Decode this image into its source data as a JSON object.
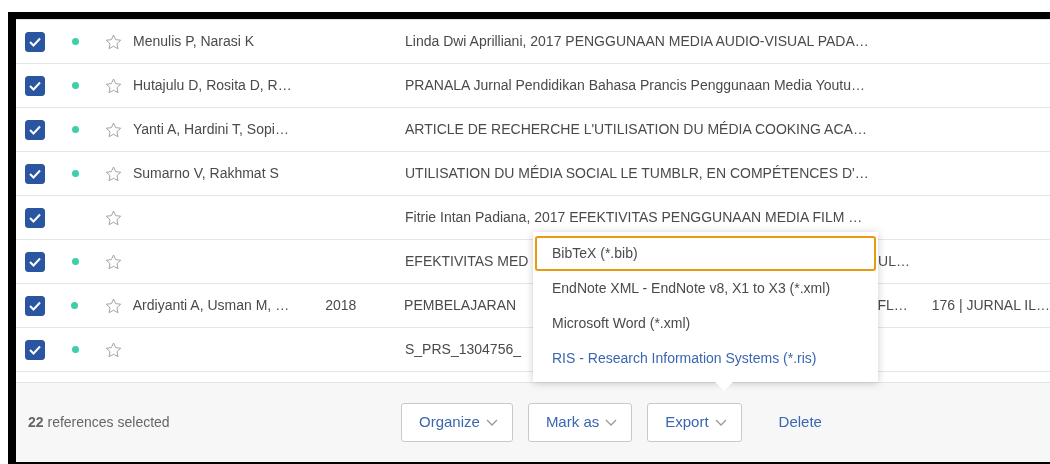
{
  "rows": [
    {
      "checked": true,
      "unread": true,
      "starred": false,
      "authors": "Menulis P, Narasi K",
      "title": "Linda Dwi Aprilliani, 2017 PENGGUNAAN MEDIA AUDIO-VISUAL PADA…"
    },
    {
      "checked": true,
      "unread": true,
      "starred": false,
      "authors": "Hutajulu D, Rosita D, R…",
      "title": "PRANALA Jurnal Pendidikan Bahasa Prancis Penggunaan Media Youtu…"
    },
    {
      "checked": true,
      "unread": true,
      "starred": false,
      "authors": "Yanti A, Hardini T, Sopi…",
      "title": "ARTICLE DE RECHERCHE L'UTILISATION DU MÉDIA COOKING ACA…"
    },
    {
      "checked": true,
      "unread": true,
      "starred": false,
      "authors": "Sumarno V, Rakhmat S",
      "title": "UTILISATION DU MÉDIA SOCIAL LE TUMBLR, EN COMPÉTENCES D'…"
    },
    {
      "checked": true,
      "unread": false,
      "starred": false,
      "title": "Fitrie Intan Padiana, 2017 EFEKTIVITAS PENGGUNAAN MEDIA FILM …"
    },
    {
      "checked": true,
      "unread": true,
      "starred": false,
      "title": "EFEKTIVITAS MED",
      "title_tail": "UL…"
    },
    {
      "checked": true,
      "unread": true,
      "starred": false,
      "authors": "Ardiyanti A, Usman M, …",
      "year": "2018",
      "title": "PEMBELAJARAN",
      "title_tail": "FL…",
      "journal": "176 | JURNAL IL…"
    },
    {
      "checked": true,
      "unread": true,
      "starred": false,
      "title": "S_PRS_1304756_"
    }
  ],
  "footer": {
    "selection": "**22** references selected",
    "buttons": [
      {
        "label": "Organize",
        "kind": "dropdown"
      },
      {
        "label": "Mark as",
        "kind": "dropdown"
      },
      {
        "label": "Export",
        "kind": "dropdown",
        "open": true
      },
      {
        "label": "Delete",
        "kind": "link"
      }
    ]
  },
  "export_menu": [
    {
      "label": "BibTeX (*.bib)",
      "focused": true,
      "hovered": false
    },
    {
      "label": "EndNote XML - EndNote v8, X1 to X3 (*.xml)",
      "focused": false,
      "hovered": false
    },
    {
      "label": "Microsoft Word (*.xml)",
      "focused": false,
      "hovered": false
    },
    {
      "label": "RIS - Research Information Systems (*.ris)",
      "focused": false,
      "hovered": true
    }
  ]
}
